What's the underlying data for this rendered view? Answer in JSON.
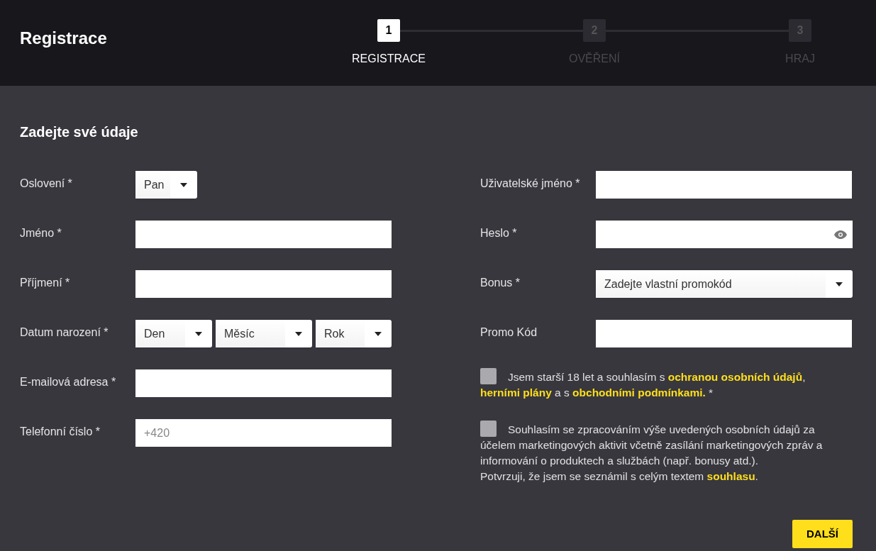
{
  "header": {
    "title": "Registrace"
  },
  "steps": [
    {
      "number": "1",
      "label": "REGISTRACE",
      "selected": true
    },
    {
      "number": "2",
      "label": "OVĚŘENÍ",
      "selected": false
    },
    {
      "number": "3",
      "label": "HRAJ",
      "selected": false
    }
  ],
  "form": {
    "heading": "Zadejte své údaje",
    "left_fields": [
      {
        "kind": "select",
        "label": "Oslovení *",
        "value": "Pan"
      },
      {
        "kind": "text",
        "label": "Jméno *"
      },
      {
        "kind": "text",
        "label": "Příjmení *"
      },
      {
        "kind": "date",
        "label": "Datum narození *",
        "selects": [
          "Den",
          "Měsíc",
          "Rok"
        ]
      },
      {
        "kind": "text",
        "label": "E-mailová adresa *"
      },
      {
        "kind": "text",
        "label": "Telefonní číslo *",
        "placeholder": "+420"
      }
    ],
    "right_fields": [
      {
        "kind": "text",
        "label": "Uživatelské jméno *"
      },
      {
        "kind": "password",
        "label": "Heslo *"
      },
      {
        "kind": "wideselect",
        "label": "Bonus *",
        "value": "Zadejte vlastní promokód"
      },
      {
        "kind": "text",
        "label": "Promo Kód"
      }
    ],
    "consents": [
      {
        "checked": false,
        "segments": [
          {
            "text": "Jsem starší 18 let a souhlasím s ",
            "link": false
          },
          {
            "text": "ochranou osobních údajů",
            "link": true
          },
          {
            "text": ", ",
            "link": false
          },
          {
            "text": "herními plány",
            "link": true
          },
          {
            "text": " a s ",
            "link": false
          },
          {
            "text": "obchodními podmínkami.",
            "link": true
          },
          {
            "text": " *",
            "link": false
          }
        ]
      },
      {
        "checked": false,
        "segments": [
          {
            "text": "Souhlasím se zpracováním výše uvedených osobních údajů za účelem marketingových aktivit včetně zasílání marketingových zpráv a informování o produktech a službách (např. bonusy atd.).",
            "link": false
          },
          {
            "text": "Potvrzuji, že jsem se seznámil s celým textem ",
            "link": false,
            "newline": true
          },
          {
            "text": "souhlasu",
            "link": true
          },
          {
            "text": ".",
            "link": false
          }
        ]
      }
    ],
    "submit": "DALŠÍ"
  }
}
